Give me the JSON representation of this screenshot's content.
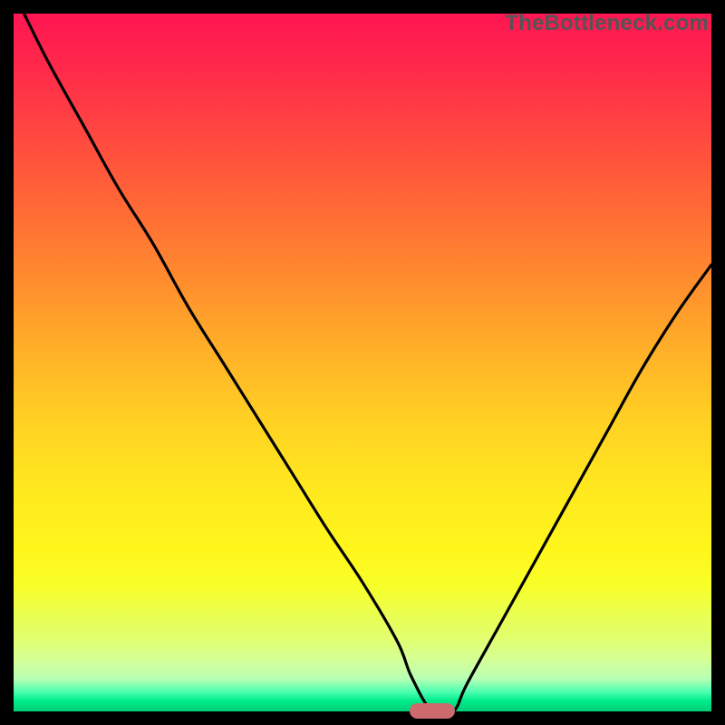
{
  "watermark": "TheBottleneck.com",
  "colors": {
    "background": "#000000",
    "gradient_top": "#ff1553",
    "gradient_bottom": "#00d078",
    "curve": "#000000",
    "marker": "#cd6a6d"
  },
  "chart_data": {
    "type": "line",
    "title": "",
    "xlabel": "",
    "ylabel": "",
    "xlim": [
      0,
      100
    ],
    "ylim": [
      0,
      100
    ],
    "minimum_point": {
      "x": 60,
      "y": 0
    },
    "marker": {
      "x_center": 60,
      "y": 0,
      "width_pct": 6.5
    },
    "series": [
      {
        "name": "bottleneck-curve",
        "x": [
          1.5,
          5,
          10,
          15,
          20,
          25,
          30,
          35,
          40,
          45,
          50,
          55,
          57,
          60,
          63,
          65,
          70,
          75,
          80,
          85,
          90,
          95,
          100
        ],
        "values": [
          100,
          93,
          84,
          75,
          67,
          58,
          50,
          42,
          34,
          26,
          18.5,
          10,
          5,
          0,
          0,
          4,
          13,
          22,
          31,
          40,
          49,
          57,
          64
        ]
      }
    ],
    "annotations": []
  }
}
